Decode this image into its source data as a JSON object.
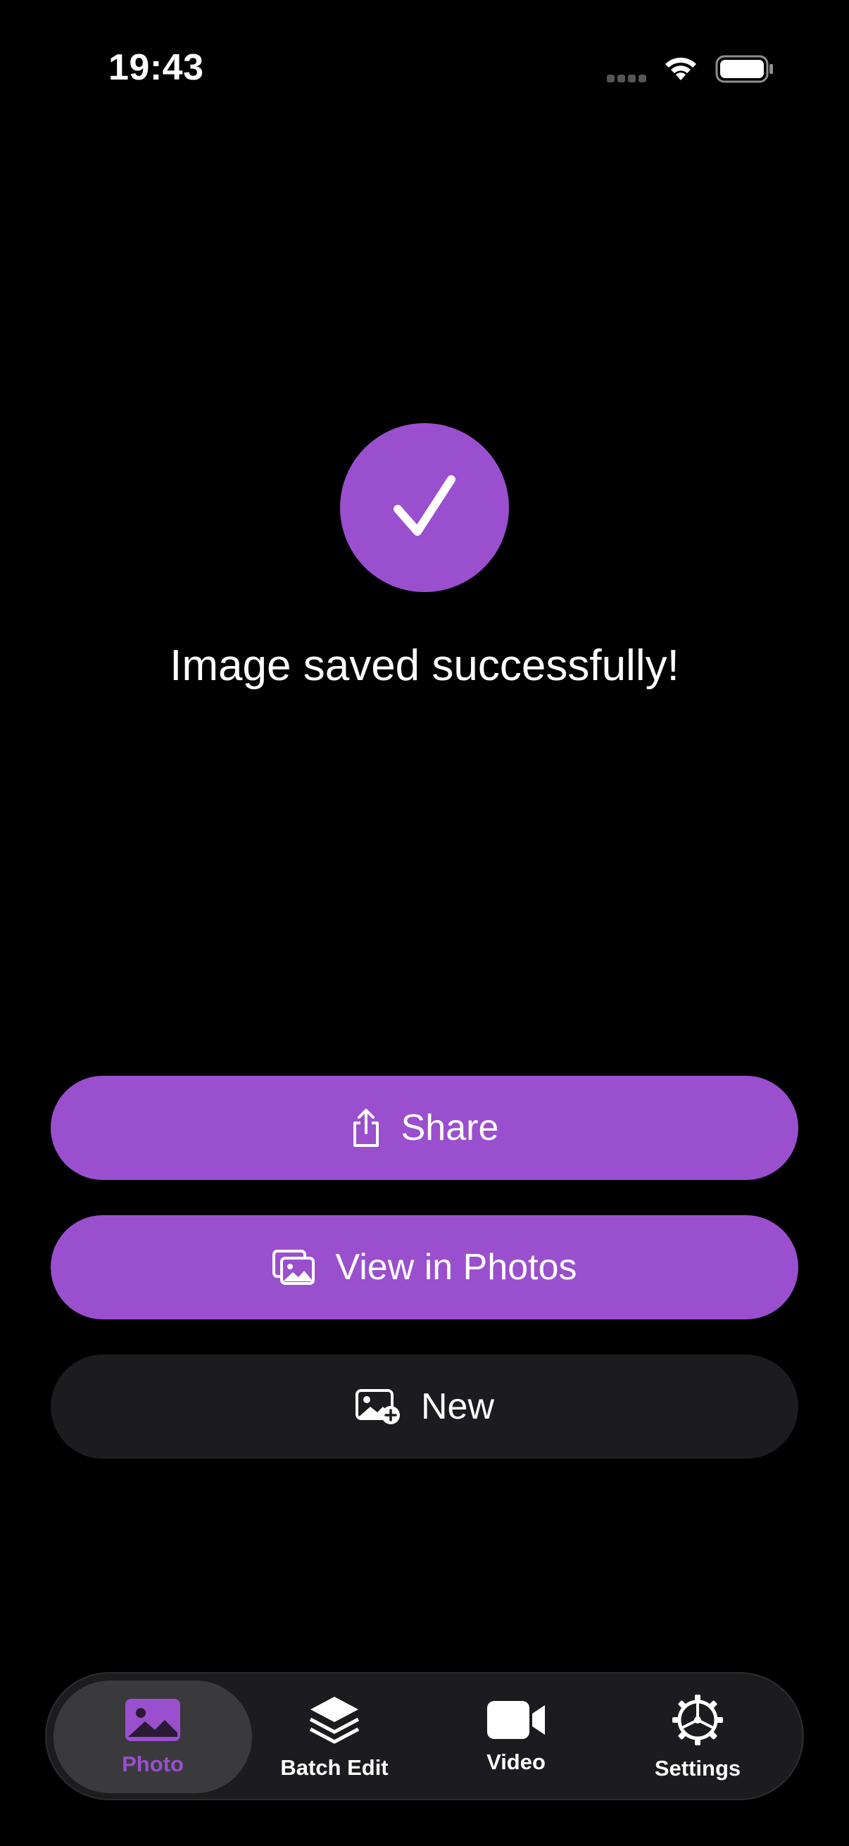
{
  "status_bar": {
    "time": "19:43"
  },
  "success": {
    "message": "Image saved successfully!"
  },
  "actions": {
    "share_label": "Share",
    "view_label": "View in Photos",
    "new_label": "New"
  },
  "tabs": [
    {
      "label": "Photo",
      "icon": "photo-icon",
      "active": true
    },
    {
      "label": "Batch Edit",
      "icon": "stack-icon",
      "active": false
    },
    {
      "label": "Video",
      "icon": "video-camera-icon",
      "active": false
    },
    {
      "label": "Settings",
      "icon": "gear-icon",
      "active": false
    }
  ],
  "colors": {
    "accent": "#9a4fce",
    "background": "#000000",
    "secondary_button": "#1c1c1e",
    "tab_bar": "#1c1c1e",
    "active_tab": "#3a3a3c"
  }
}
